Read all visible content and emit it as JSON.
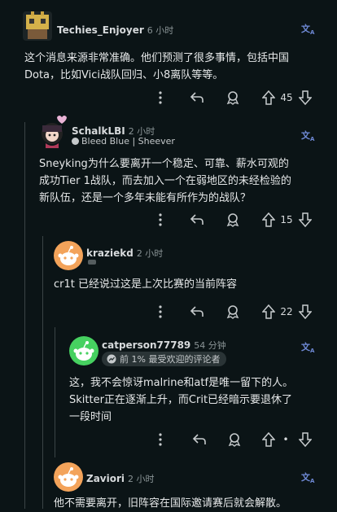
{
  "comments": [
    {
      "user": "Techies_Enjoyer",
      "time": "6 小时",
      "text_lines": [
        "这个消息来源非常准确。他们预测了很多事情，包括中国",
        "Dota，比如Vici战队回归、小8离队等等。"
      ],
      "votes": "45"
    },
    {
      "user": "SchalkLBI",
      "time": "2 小时",
      "flair": "Bleed Blue | Sheever",
      "text_lines": [
        "Sneyking为什么要离开一个稳定、可靠、薪水可观的",
        "成功Tier 1战队，而去加入一个在弱地区的未经检验的",
        "新队伍，还是一个多年未能有所作为的战队？"
      ],
      "votes": "15"
    },
    {
      "user": "kraziekd",
      "time": "2 小时",
      "text_lines": [
        "cr1t 已经说过这是上次比赛的当前阵容"
      ],
      "votes": "22"
    },
    {
      "user": "catperson77789",
      "time": "54 分钟",
      "badge": "前 1% 最受欢迎的评论者",
      "text_lines": [
        "这，我不会惊讶malrine和atf是唯一留下的人。",
        "Skitter正在逐渐上升，而Crit已经暗示要退休了",
        "一段时间"
      ],
      "votes": "•"
    },
    {
      "user": "Zaviori",
      "time": "2 小时",
      "text_lines": [
        "他不需要离开，旧阵容在国际邀请赛后就会解散。"
      ]
    }
  ],
  "colors": {
    "background": "#0b1416",
    "text": "#d7dadc",
    "translate": "#6f8ad6",
    "thread": "#3a4446"
  }
}
